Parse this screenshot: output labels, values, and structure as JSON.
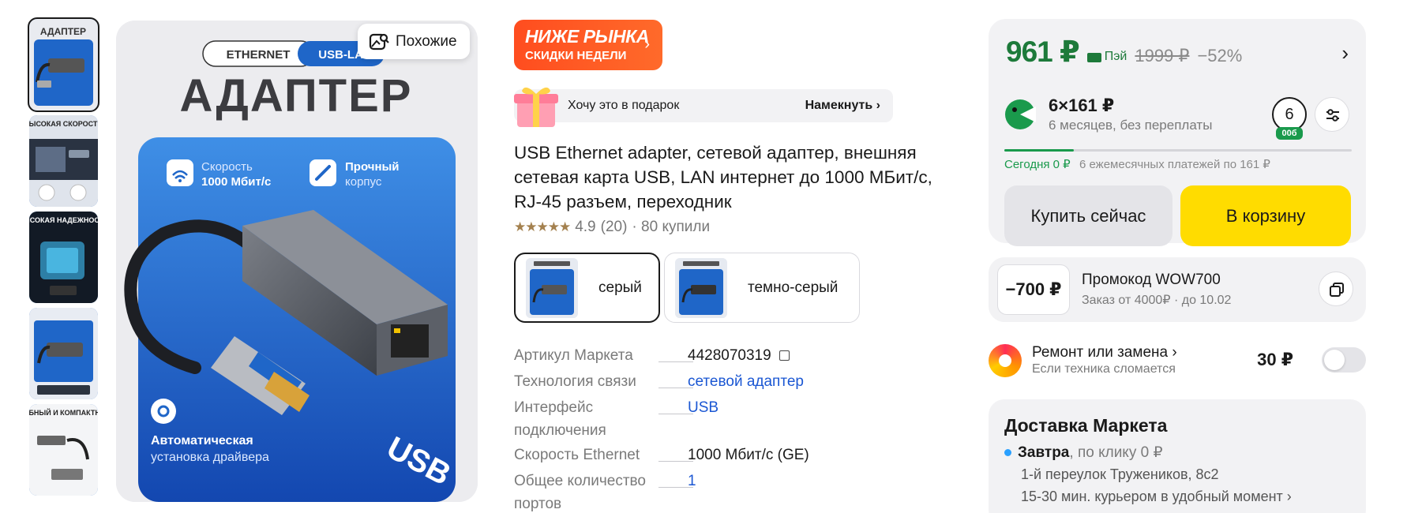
{
  "gallery": {
    "thumbs": [
      {
        "label": "АДАПТЕР"
      },
      {
        "label": "ВЫСОКАЯ СКОРОСТЬ"
      },
      {
        "label": "ВЫСОКАЯ НАДЕЖНОСТЬ"
      },
      {
        "label": ""
      },
      {
        "label": "УДОБНЫЙ И КОМПАКТНЫЙ"
      }
    ],
    "similar_label": "Похожие",
    "main": {
      "tab_ethernet": "ETHERNET",
      "tab_usb": "USB-LAN",
      "heading": "АДАПТЕР",
      "feature1_line1": "Скорость",
      "feature1_line2": "1000 Мбит/с",
      "feature2_line1": "Прочный",
      "feature2_line2": "корпус",
      "auto_line1": "Автоматическая",
      "auto_line2": "установка драйвера",
      "usb_text": "USB"
    }
  },
  "badge": {
    "title": "НИЖЕ РЫНКА",
    "subtitle": "СКИДКИ НЕДЕЛИ",
    "chevron": "›"
  },
  "gift": {
    "text": "Хочу это в подарок",
    "hint": "Намекнуть ›"
  },
  "product": {
    "title": "USB Ethernet adapter, сетевой адаптер, внешняя сетевая карта USB, LAN интернет до 1000 МБит/с, RJ-45 разъем, переходник",
    "stars": "★★★★★",
    "rating": "4.9",
    "reviews": "(20)",
    "sold": "· 80 купили",
    "rating_value": 4.9
  },
  "variants": [
    {
      "label": "серый",
      "selected": true
    },
    {
      "label": "темно-серый",
      "selected": false
    }
  ],
  "specs": [
    {
      "key": "Артикул Маркета",
      "value": "4428070319",
      "link": false
    },
    {
      "key": "Технология связи",
      "value": "сетевой адаптер",
      "link": true
    },
    {
      "key": "Интерфейс подключения",
      "value": "USB",
      "link": true
    },
    {
      "key": "Скорость Ethernet",
      "value": "1000 Мбит/с (GE)",
      "link": false
    },
    {
      "key": "Общее количество портов",
      "value": "1",
      "link": true
    }
  ],
  "price": {
    "current": "961 ₽",
    "pay_label": "Пэй",
    "old": "1999 ₽",
    "discount": "−52%",
    "chevron": "›"
  },
  "split": {
    "main": "6×161 ₽",
    "sub": "6 месяцев, без переплаты",
    "badge_number": "6",
    "badge_sub": "00б",
    "today": "Сегодня 0 ₽",
    "monthly": "6 ежемесячных платежей по 161 ₽",
    "progress": 0.2
  },
  "buttons": {
    "buy_now": "Купить сейчас",
    "add_to_cart": "В корзину"
  },
  "promo": {
    "amount": "−700 ₽",
    "title": "Промокод WOW700",
    "subtitle": "Заказ от 4000₽ · до 10.02"
  },
  "repair": {
    "title": "Ремонт или замена ›",
    "subtitle": "Если техника сломается",
    "price": "30 ₽"
  },
  "delivery": {
    "title": "Доставка Маркета",
    "day": "Завтра",
    "by_click": ", по клику  0 ₽",
    "address": "1-й переулок Тружеников, 8с2",
    "time": "15-30 мин. курьером в удобный момент ›"
  },
  "colors": {
    "price_green": "#1d7a3a",
    "cart_yellow": "#ffdc00",
    "badge_orange": "#ff4d1f",
    "link_blue": "#1b57d3",
    "product_blue": "#1f66c8"
  }
}
